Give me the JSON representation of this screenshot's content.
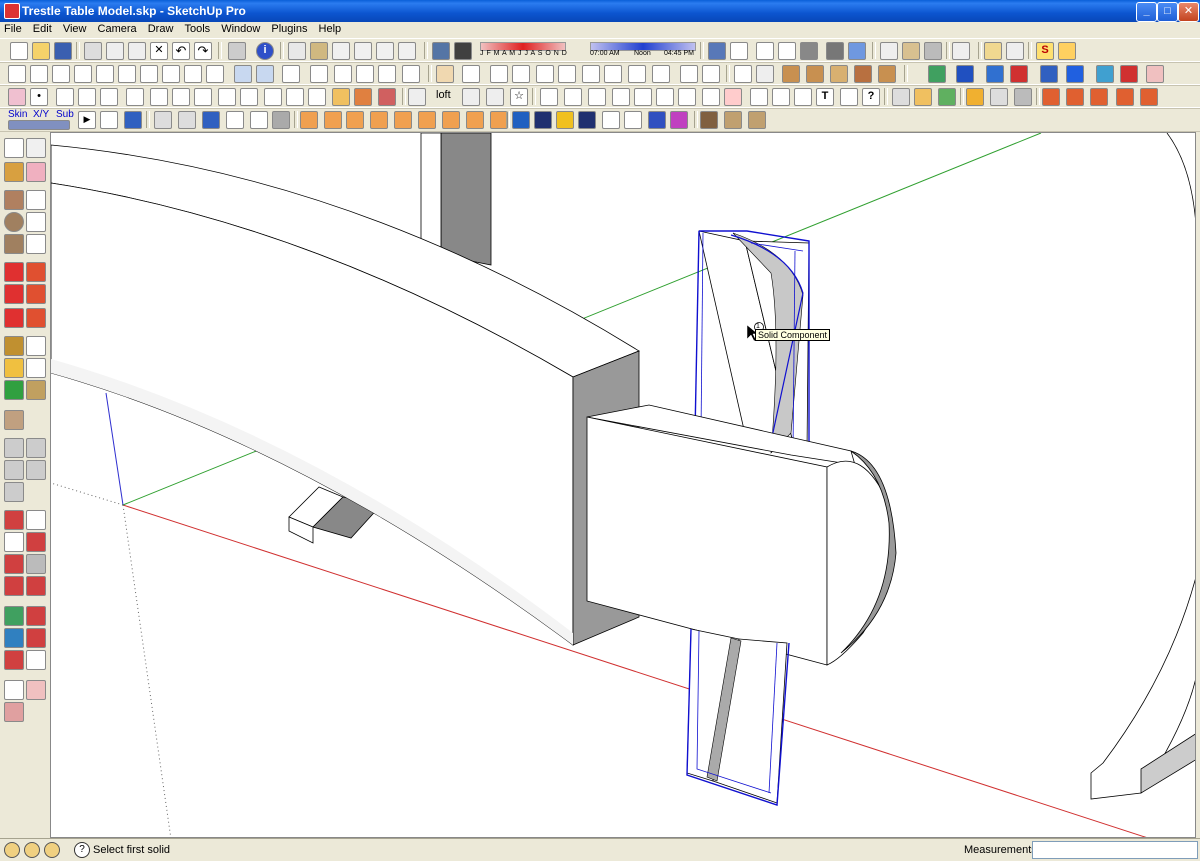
{
  "window": {
    "title": "Trestle Table Model.skp - SketchUp Pro",
    "minimize": "_",
    "maximize": "□",
    "close": "✕"
  },
  "menu": [
    "File",
    "Edit",
    "View",
    "Camera",
    "Draw",
    "Tools",
    "Window",
    "Plugins",
    "Help"
  ],
  "shadows": {
    "months": "J F M A M J J A S O N D",
    "time_start": "07:00 AM",
    "time_noon": "Noon",
    "time_end": "04:45 PM"
  },
  "toolbar_labels": {
    "loft": "loft",
    "skin": "Skin",
    "xy": "X/Y",
    "sub": "Sub"
  },
  "viewport": {
    "tooltip_number": "1",
    "tooltip_text": "Solid Component"
  },
  "status": {
    "message": "Select first solid",
    "measurements_label": "Measurements",
    "measurements_value": ""
  }
}
